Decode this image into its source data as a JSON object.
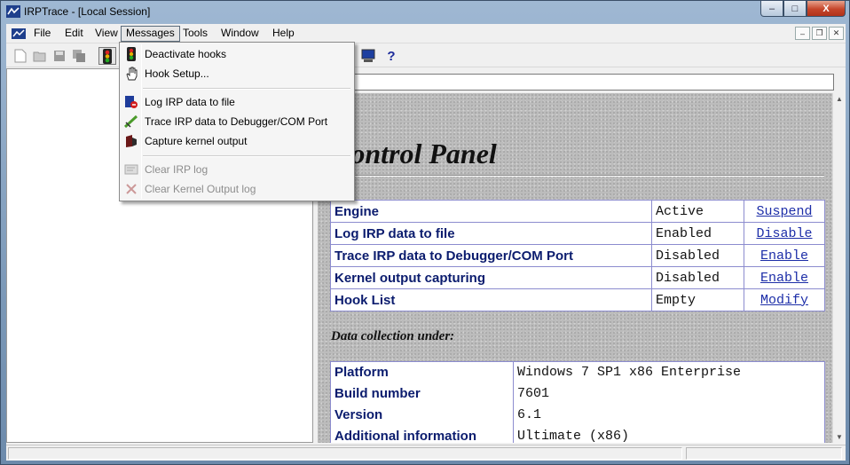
{
  "window": {
    "title": "IRPTrace - [Local Session]",
    "controls": {
      "minimize": "–",
      "maximize": "□",
      "close": "X"
    }
  },
  "menubar": {
    "items": [
      "File",
      "Edit",
      "View",
      "Messages",
      "Tools",
      "Window",
      "Help"
    ],
    "open_item": "Messages",
    "mdi": {
      "minimize": "–",
      "restore": "❐",
      "close": "✕"
    }
  },
  "toolbar": {
    "buttons": [
      "new-document-icon",
      "open-folder-icon",
      "save-icon",
      "save-all-icon",
      "traffic-light-icon",
      "monitor-icon",
      "help-icon"
    ],
    "help_label": "?"
  },
  "messages_menu": {
    "items": [
      {
        "label": "Deactivate hooks",
        "icon": "traffic-light-icon",
        "enabled": true
      },
      {
        "label": "Hook Setup...",
        "icon": "hand-icon",
        "enabled": true
      },
      {
        "label": "Log IRP data to file",
        "icon": "log-file-icon",
        "enabled": true
      },
      {
        "label": "Trace IRP data to Debugger/COM Port",
        "icon": "trace-icon",
        "enabled": true
      },
      {
        "label": "Capture kernel output",
        "icon": "capture-icon",
        "enabled": true
      },
      {
        "label": "Clear IRP log",
        "icon": "clear-log-icon",
        "enabled": false
      },
      {
        "label": "Clear Kernel Output log",
        "icon": "clear-kernel-icon",
        "enabled": false
      }
    ]
  },
  "control_panel": {
    "title": "Control Panel",
    "status_rows": [
      {
        "label": "Engine",
        "value": "Active",
        "action": "Suspend"
      },
      {
        "label": "Log IRP data to file",
        "value": "Enabled",
        "action": "Disable"
      },
      {
        "label": "Trace IRP data to Debugger/COM Port",
        "value": "Disabled",
        "action": "Enable"
      },
      {
        "label": "Kernel output capturing",
        "value": "Disabled",
        "action": "Enable"
      },
      {
        "label": "Hook List",
        "value": "Empty",
        "action": "Modify"
      }
    ],
    "data_heading": "Data collection under:",
    "info_rows": [
      {
        "label": "Platform",
        "value": "Windows 7 SP1 x86 Enterprise"
      },
      {
        "label": "Build number",
        "value": "7601"
      },
      {
        "label": "Version",
        "value": "6.1"
      },
      {
        "label": "Additional information",
        "value": "Ultimate (x86)"
      }
    ]
  },
  "colors": {
    "label_text": "#0b1c6e",
    "link_text": "#1d2ea8",
    "table_border": "#8c8ccf",
    "close_button": "#c5452a"
  }
}
